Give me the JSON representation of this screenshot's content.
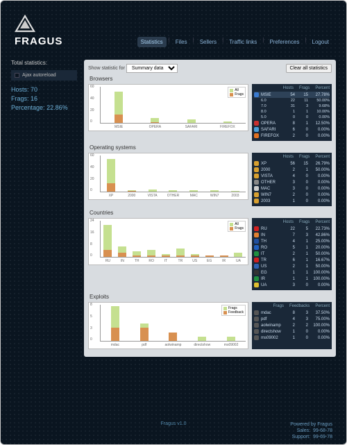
{
  "app": {
    "name": "FRAGUS",
    "version": "Fragus v1.0"
  },
  "nav": {
    "items": [
      "Statistics",
      "Files",
      "Sellers",
      "Traffic links",
      "Preferences",
      "Logout"
    ],
    "active": 0
  },
  "sidebar": {
    "title": "Total statistics:",
    "autoreload": "Ajax autoreload",
    "hosts_lbl": "Hosts:",
    "hosts": "70",
    "frags_lbl": "Frags:",
    "frags": "16",
    "pct_lbl": "Percentage:",
    "pct": "22.86%"
  },
  "top": {
    "show_lbl": "Show statistic for",
    "select": "Summary data",
    "clear": "Clear all statistics"
  },
  "sections": {
    "browsers": {
      "title": "Browsers",
      "legend": [
        "All",
        "Frags"
      ],
      "head": [
        "Hosts",
        "Frags",
        "Percent"
      ],
      "rows": [
        {
          "name": "MSIE",
          "hosts": "54",
          "frags": "15",
          "pct": "27.78%",
          "icon": "#3a7acf",
          "hl": true
        },
        {
          "name": "6.0",
          "hosts": "22",
          "frags": "11",
          "pct": "50.00%",
          "sub": true
        },
        {
          "name": "7.0",
          "hosts": "31",
          "frags": "3",
          "pct": "9.68%",
          "sub": true
        },
        {
          "name": "8.0",
          "hosts": "1",
          "frags": "1",
          "pct": "10.00%",
          "sub": true
        },
        {
          "name": "5.0",
          "hosts": "0",
          "frags": "0",
          "pct": "0.00%",
          "sub": true
        },
        {
          "name": "OPERA",
          "hosts": "8",
          "frags": "1",
          "pct": "12.50%",
          "icon": "#c73030"
        },
        {
          "name": "SAFARI",
          "hosts": "6",
          "frags": "0",
          "pct": "0.00%",
          "icon": "#4a9ed8"
        },
        {
          "name": "FIREFOX",
          "hosts": "2",
          "frags": "0",
          "pct": "0.00%",
          "icon": "#e07020"
        }
      ]
    },
    "os": {
      "title": "Operating systems",
      "head": [
        "Hosts",
        "Frags",
        "Percent"
      ],
      "rows": [
        {
          "name": "XP",
          "hosts": "56",
          "frags": "15",
          "pct": "26.79%",
          "icon": "#d8a030"
        },
        {
          "name": "2000",
          "hosts": "2",
          "frags": "1",
          "pct": "50.00%",
          "icon": "#d8a030"
        },
        {
          "name": "VISTA",
          "hosts": "4",
          "frags": "0",
          "pct": "0.00%",
          "icon": "#d8a030"
        },
        {
          "name": "OTHER",
          "hosts": "3",
          "frags": "0",
          "pct": "0.00%",
          "icon": "#888"
        },
        {
          "name": "MAC",
          "hosts": "3",
          "frags": "0",
          "pct": "0.00%",
          "icon": "#ccc"
        },
        {
          "name": "WIN7",
          "hosts": "2",
          "frags": "0",
          "pct": "0.00%",
          "icon": "#d8a030"
        },
        {
          "name": "2003",
          "hosts": "1",
          "frags": "0",
          "pct": "0.00%",
          "icon": "#d8a030"
        }
      ]
    },
    "countries": {
      "title": "Countries",
      "legend": [
        "All",
        "Frags"
      ],
      "head": [
        "Hosts",
        "Frags",
        "Percent"
      ],
      "rows": [
        {
          "name": "RU",
          "hosts": "22",
          "frags": "5",
          "pct": "22.73%",
          "icon": "#d02020"
        },
        {
          "name": "IN",
          "hosts": "7",
          "frags": "3",
          "pct": "42.86%",
          "icon": "#e08030"
        },
        {
          "name": "TH",
          "hosts": "4",
          "frags": "1",
          "pct": "25.00%",
          "icon": "#2050a0"
        },
        {
          "name": "RO",
          "hosts": "5",
          "frags": "1",
          "pct": "20.00%",
          "icon": "#2060c0"
        },
        {
          "name": "IT",
          "hosts": "2",
          "frags": "1",
          "pct": "50.00%",
          "icon": "#209040"
        },
        {
          "name": "TR",
          "hosts": "6",
          "frags": "1",
          "pct": "16.67%",
          "icon": "#d02020"
        },
        {
          "name": "US",
          "hosts": "2",
          "frags": "1",
          "pct": "50.00%",
          "icon": "#3060b0"
        },
        {
          "name": "EG",
          "hosts": "1",
          "frags": "1",
          "pct": "100.00%",
          "icon": "#333"
        },
        {
          "name": "IR",
          "hosts": "1",
          "frags": "1",
          "pct": "100.00%",
          "icon": "#209040"
        },
        {
          "name": "UA",
          "hosts": "3",
          "frags": "0",
          "pct": "0.00%",
          "icon": "#e0c030"
        }
      ]
    },
    "exploits": {
      "title": "Exploits",
      "legend": [
        "Frags",
        "Feedback"
      ],
      "head": [
        "Frags",
        "Feedbacks",
        "Percent"
      ],
      "rows": [
        {
          "name": "mdac",
          "frags": "8",
          "fb": "3",
          "pct": "37.50%"
        },
        {
          "name": "pdf",
          "frags": "4",
          "fb": "3",
          "pct": "75.00%"
        },
        {
          "name": "aolwinamp",
          "frags": "2",
          "fb": "2",
          "pct": "100.00%"
        },
        {
          "name": "directshow",
          "frags": "1",
          "fb": "0",
          "pct": "0.00%"
        },
        {
          "name": "ms09002",
          "frags": "1",
          "fb": "0",
          "pct": "0.00%"
        }
      ]
    }
  },
  "chart_data": [
    {
      "type": "bar",
      "title": "Browsers",
      "categories": [
        "MSIE",
        "OPERA",
        "SAFARI",
        "FIREFOX"
      ],
      "series": [
        {
          "name": "All",
          "values": [
            54,
            8,
            6,
            2
          ]
        },
        {
          "name": "Frags",
          "values": [
            15,
            1,
            0,
            0
          ]
        }
      ],
      "ylim": [
        0,
        60
      ]
    },
    {
      "type": "bar",
      "title": "Operating systems",
      "categories": [
        "XP",
        "2000",
        "VISTA",
        "OTHER",
        "MAC",
        "WIN7",
        "2003"
      ],
      "series": [
        {
          "name": "All",
          "values": [
            56,
            2,
            4,
            3,
            3,
            2,
            1
          ]
        },
        {
          "name": "Frags",
          "values": [
            15,
            1,
            0,
            0,
            0,
            0,
            0
          ]
        }
      ],
      "ylim": [
        0,
        60
      ]
    },
    {
      "type": "bar",
      "title": "Countries",
      "categories": [
        "RU",
        "IN",
        "TH",
        "RO",
        "IT",
        "TR",
        "US",
        "EG",
        "IR",
        "UA"
      ],
      "series": [
        {
          "name": "All",
          "values": [
            22,
            7,
            4,
            5,
            2,
            6,
            2,
            1,
            1,
            3
          ]
        },
        {
          "name": "Frags",
          "values": [
            5,
            3,
            1,
            1,
            1,
            1,
            1,
            1,
            1,
            0
          ]
        }
      ],
      "ylim": [
        0,
        24
      ]
    },
    {
      "type": "bar",
      "title": "Exploits",
      "categories": [
        "mdac",
        "pdf",
        "aolwinamp",
        "directshow",
        "ms09002"
      ],
      "series": [
        {
          "name": "Frags",
          "values": [
            8,
            4,
            2,
            1,
            1
          ]
        },
        {
          "name": "Feedback",
          "values": [
            3,
            3,
            2,
            0,
            0
          ]
        }
      ],
      "ylim": [
        0,
        8
      ]
    }
  ],
  "footer": {
    "powered": "Powered by Fragus",
    "sales_lbl": "Sales:",
    "sales": "99-68-78",
    "support_lbl": "Support:",
    "support": "99-69-78"
  }
}
